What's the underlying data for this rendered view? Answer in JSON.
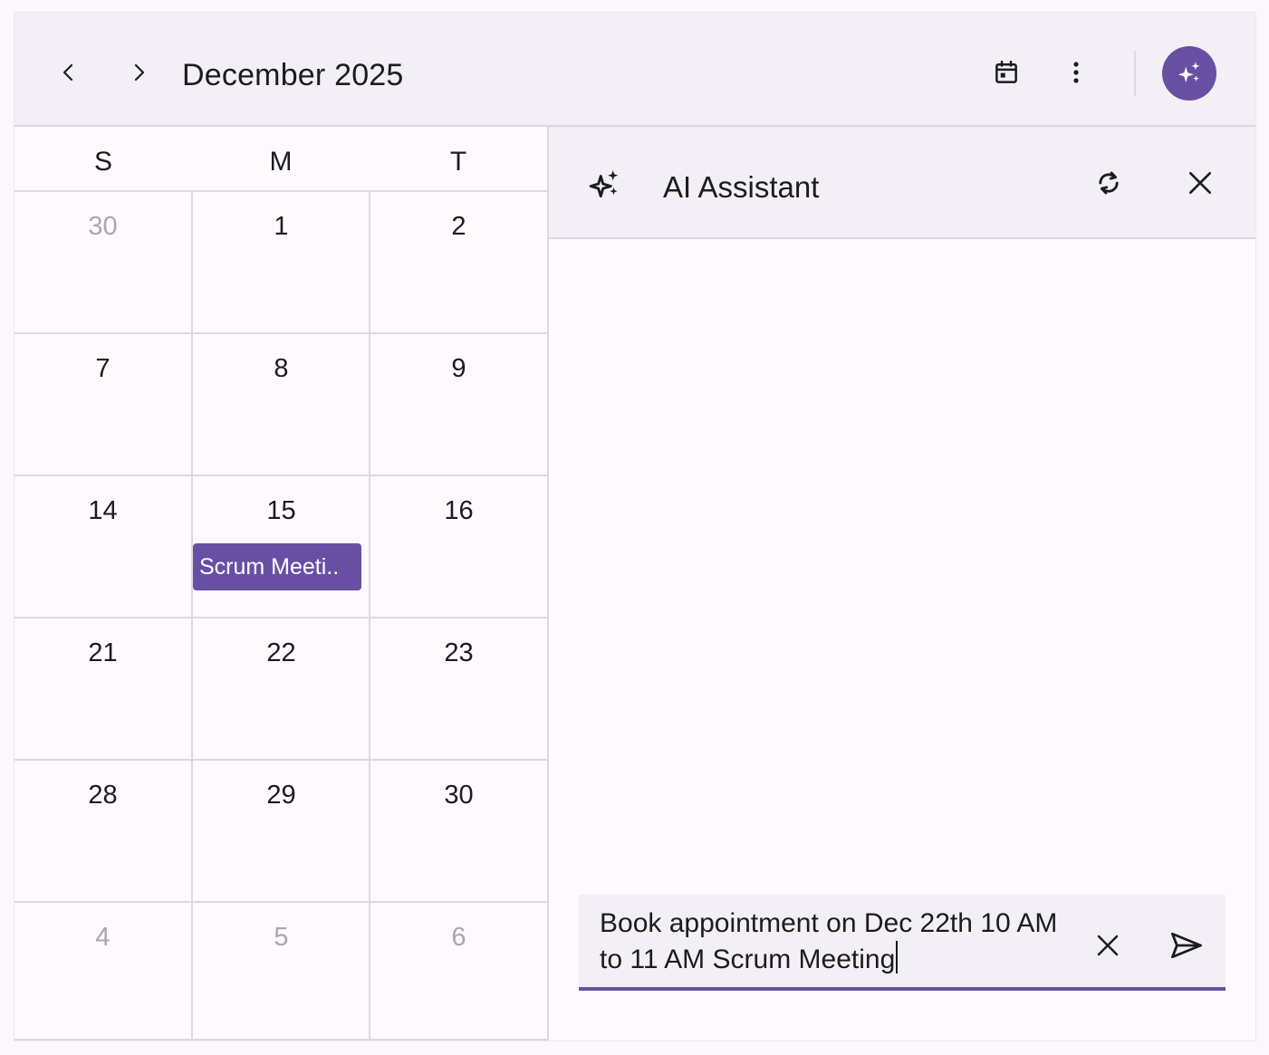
{
  "header": {
    "title": "December 2025",
    "prev_icon": "chevron-left-icon",
    "next_icon": "chevron-right-icon",
    "today_icon": "calendar-today-icon",
    "more_icon": "more-vert-icon",
    "ai_icon": "sparkle-icon"
  },
  "calendar": {
    "days_of_week": [
      "S",
      "M",
      "T"
    ],
    "weeks": [
      [
        {
          "day": "30",
          "muted": true
        },
        {
          "day": "1",
          "muted": false
        },
        {
          "day": "2",
          "muted": false
        }
      ],
      [
        {
          "day": "7",
          "muted": false
        },
        {
          "day": "8",
          "muted": false
        },
        {
          "day": "9",
          "muted": false
        }
      ],
      [
        {
          "day": "14",
          "muted": false
        },
        {
          "day": "15",
          "muted": false
        },
        {
          "day": "16",
          "muted": false
        }
      ],
      [
        {
          "day": "21",
          "muted": false
        },
        {
          "day": "22",
          "muted": false
        },
        {
          "day": "23",
          "muted": false
        }
      ],
      [
        {
          "day": "28",
          "muted": false
        },
        {
          "day": "29",
          "muted": false
        },
        {
          "day": "30",
          "muted": false
        }
      ],
      [
        {
          "day": "4",
          "muted": true
        },
        {
          "day": "5",
          "muted": true
        },
        {
          "day": "6",
          "muted": true
        }
      ]
    ],
    "event": {
      "label": "Scrum Meeti..",
      "color": "#6750a4"
    }
  },
  "assistant": {
    "title": "AI Assistant",
    "icon": "sparkle-icon",
    "refresh_icon": "refresh-icon",
    "close_icon": "close-icon",
    "input_value": "Book appointment on Dec 22th 10 AM to 11 AM Scrum Meeting",
    "clear_icon": "close-icon",
    "send_icon": "send-icon"
  },
  "colors": {
    "accent": "#6750a4",
    "header_bg": "#f3eff7",
    "muted_text": "#a9a6ad"
  }
}
